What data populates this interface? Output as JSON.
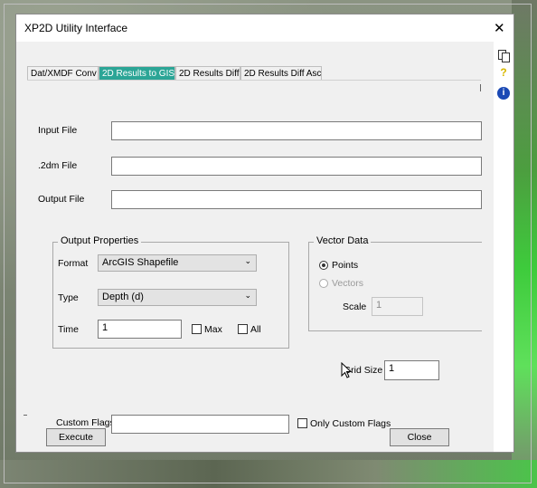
{
  "window": {
    "title": "XP2D Utility Interface",
    "close_glyph": "✕"
  },
  "side_panel": {
    "help_glyph": "?",
    "info_glyph": "i"
  },
  "tabs": [
    {
      "label": "Dat/XMDF Conv",
      "active": false
    },
    {
      "label": "2D Results to GIS",
      "active": true
    },
    {
      "label": "2D Results Diff",
      "active": false
    },
    {
      "label": "2D Results Diff Asc",
      "active": false
    }
  ],
  "files": {
    "input_label": "Input File",
    "input_value": "",
    "mesh_label": ".2dm File",
    "mesh_value": "",
    "output_label": "Output File",
    "output_value": ""
  },
  "output_properties": {
    "title": "Output Properties",
    "format_label": "Format",
    "format_value": "ArcGIS Shapefile",
    "type_label": "Type",
    "type_value": "Depth (d)",
    "time_label": "Time",
    "time_value": "1",
    "max_label": "Max",
    "max_checked": false,
    "all_label": "All",
    "all_checked": false
  },
  "vector_data": {
    "title": "Vector Data",
    "points_label": "Points",
    "points_selected": true,
    "vectors_label": "Vectors",
    "vectors_selected": false,
    "scale_label": "Scale",
    "scale_value": "1"
  },
  "grid": {
    "label": "Grid Size",
    "value": "1"
  },
  "custom_flags": {
    "label": "Custom Flags",
    "value": "",
    "only_label": "Only Custom Flags",
    "only_checked": false
  },
  "buttons": {
    "execute": "Execute",
    "close": "Close"
  },
  "colors": {
    "active_tab": "#2ba596",
    "info_icon": "#1b49b5",
    "help_icon": "#d8b800"
  }
}
